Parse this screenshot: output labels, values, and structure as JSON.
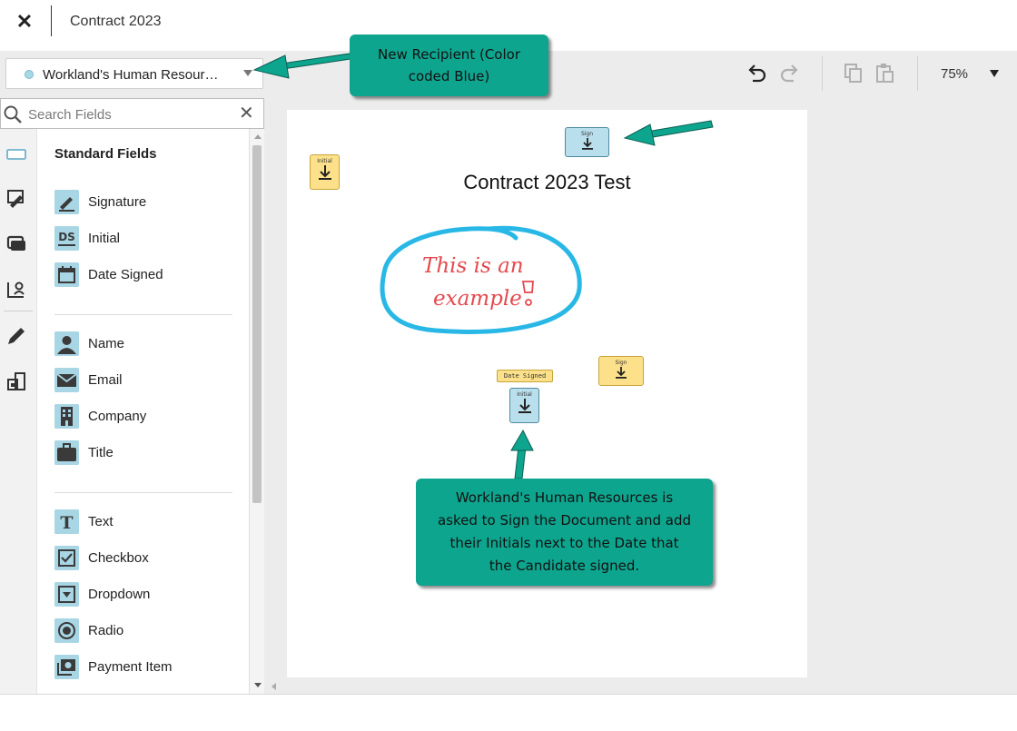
{
  "header": {
    "title": "Contract 2023"
  },
  "toolbar": {
    "recipient": "Workland's Human Resour…",
    "recipient_color": "#a7d8e6",
    "zoom": "75%"
  },
  "search": {
    "placeholder": "Search Fields"
  },
  "sidebar": {
    "heading": "Standard Fields",
    "groups": [
      {
        "items": [
          {
            "label": "Signature",
            "icon": "signature-icon"
          },
          {
            "label": "Initial",
            "icon": "initial-icon"
          },
          {
            "label": "Date Signed",
            "icon": "calendar-icon"
          }
        ]
      },
      {
        "items": [
          {
            "label": "Name",
            "icon": "person-icon"
          },
          {
            "label": "Email",
            "icon": "envelope-icon"
          },
          {
            "label": "Company",
            "icon": "building-icon"
          },
          {
            "label": "Title",
            "icon": "briefcase-icon"
          }
        ]
      },
      {
        "items": [
          {
            "label": "Text",
            "icon": "text-icon"
          },
          {
            "label": "Checkbox",
            "icon": "checkbox-icon"
          },
          {
            "label": "Dropdown",
            "icon": "dropdown-icon"
          },
          {
            "label": "Radio",
            "icon": "radio-icon"
          },
          {
            "label": "Payment Item",
            "icon": "payment-icon"
          }
        ]
      }
    ]
  },
  "document": {
    "title": "Contract 2023 Test",
    "handwriting_line1": "This is an",
    "handwriting_line2": "example",
    "tags": {
      "sign_top": "Sign",
      "initial_left": "Initial",
      "sign_right": "Sign",
      "date_signed": "Date Signed",
      "initial_center": "Initial"
    }
  },
  "callouts": {
    "new_recipient_line1": "New Recipient (Color",
    "new_recipient_line2": "coded Blue)",
    "explain_line1": "Workland's Human Resources is",
    "explain_line2": "asked to Sign the Document and add",
    "explain_line3": "their Initials next to the Date that",
    "explain_line4": "the Candidate signed."
  },
  "colors": {
    "callout": "#0ea58f",
    "field_blue": "#b9dfec",
    "field_yellow": "#fce08a",
    "circle_stroke": "#29b8e6",
    "handwriting": "#e5484d"
  }
}
